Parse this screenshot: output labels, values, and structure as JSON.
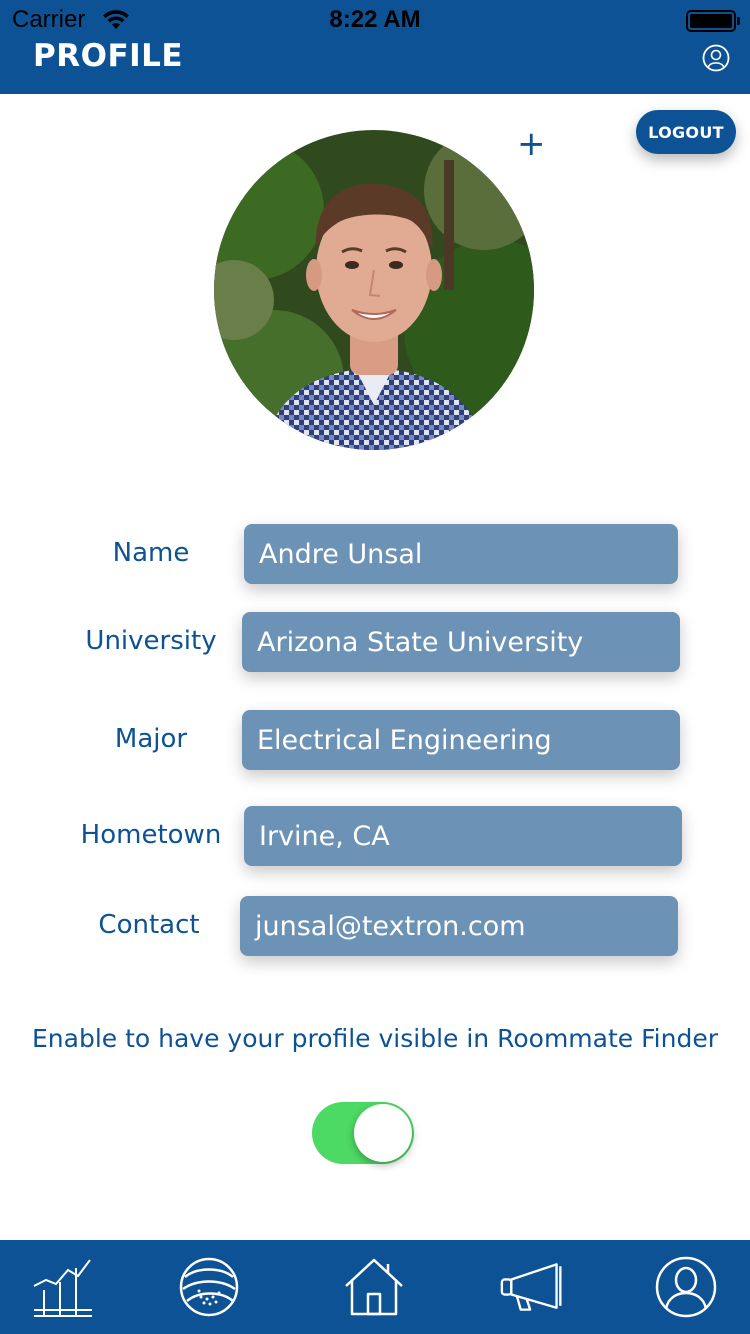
{
  "status_bar": {
    "carrier": "Carrier",
    "time": "8:22 AM"
  },
  "header": {
    "title": "PROFILE",
    "user_icon": "user-circle-icon"
  },
  "actions": {
    "logout_label": "LOGOUT",
    "add_photo_label": "+"
  },
  "profile": {
    "avatar_icon": "profile-photo",
    "fields": [
      {
        "label": "Name",
        "value": "Andre Unsal"
      },
      {
        "label": "University",
        "value": "Arizona State University"
      },
      {
        "label": "Major",
        "value": "Electrical Engineering"
      },
      {
        "label": "Hometown",
        "value": "Irvine, CA"
      },
      {
        "label": "Contact",
        "value": "junsal@textron.com"
      }
    ]
  },
  "visibility": {
    "text": "Enable to have your profile visible in Roommate Finder",
    "enabled": true
  },
  "tabbar": {
    "tabs": [
      {
        "icon": "chart-icon"
      },
      {
        "icon": "globe-icon"
      },
      {
        "icon": "home-icon"
      },
      {
        "icon": "megaphone-icon"
      },
      {
        "icon": "user-circle-icon"
      }
    ]
  },
  "colors": {
    "primary": "#0d5294",
    "field": "#6c92b6",
    "toggle_on": "#4cd964"
  }
}
